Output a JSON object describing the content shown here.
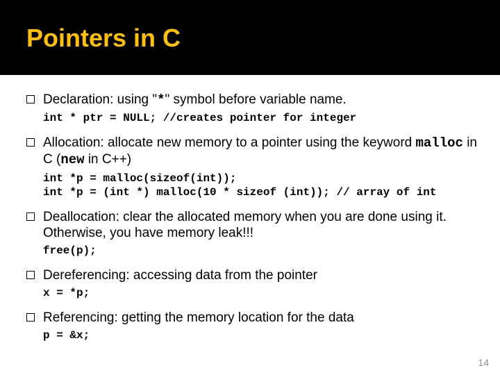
{
  "title": "Pointers in C",
  "items": {
    "decl": {
      "text_pre": "Declaration:  using \"",
      "star": "*",
      "text_post": "\" symbol before variable name.",
      "code": "int * ptr = NULL; //creates pointer for integer"
    },
    "alloc": {
      "text_pre": "Allocation: allocate new memory to a pointer using the keyword ",
      "kw1": "malloc",
      "mid": " in C (",
      "kw2": "new",
      "post": " in C++)",
      "code1": "int *p = malloc(sizeof(int));",
      "code2": "int *p = (int *) malloc(10 * sizeof (int)); // array of int"
    },
    "dealloc": {
      "text": "Deallocation: clear the allocated memory when you are done using it.  Otherwise, you have memory leak!!!",
      "code": "free(p);"
    },
    "deref": {
      "text": "Dereferencing: accessing data from the pointer",
      "code": "x = *p;"
    },
    "ref": {
      "text": "Referencing: getting the memory location for the data",
      "code": "p = &x;"
    }
  },
  "page_number": "14"
}
